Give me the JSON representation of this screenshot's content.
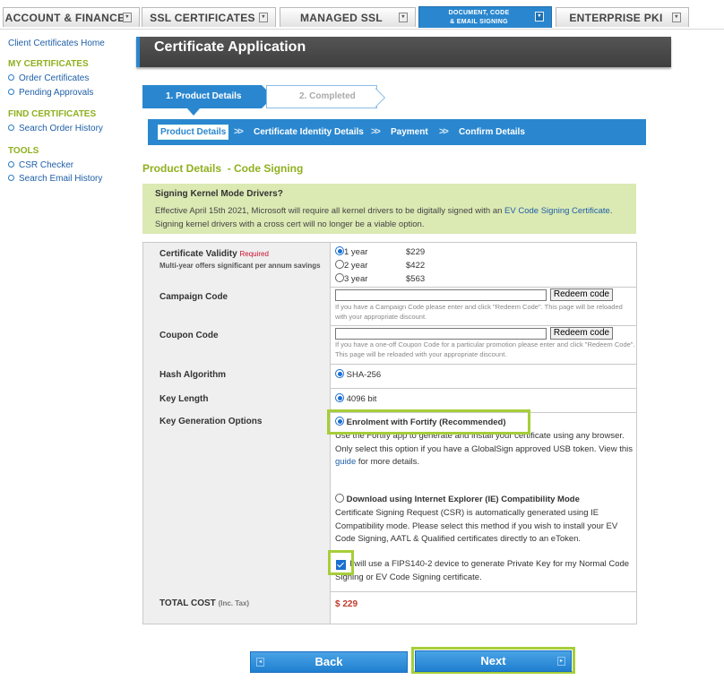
{
  "topnav": {
    "tabs": [
      {
        "label": "ACCOUNT & FINANCE"
      },
      {
        "label": "SSL CERTIFICATES"
      },
      {
        "label": "MANAGED SSL"
      },
      {
        "label_line1": "DOCUMENT, CODE",
        "label_line2": "& EMAIL SIGNING",
        "active": true
      },
      {
        "label": "ENTERPRISE PKI"
      }
    ]
  },
  "sidebar": {
    "home": "Client Certificates Home",
    "sections": [
      {
        "title": "MY CERTIFICATES",
        "items": [
          "Order Certificates",
          "Pending Approvals"
        ]
      },
      {
        "title": "FIND CERTIFICATES",
        "items": [
          "Search Order History"
        ]
      },
      {
        "title": "TOOLS",
        "items": [
          "CSR Checker",
          "Search Email History"
        ]
      }
    ]
  },
  "page_title": "Certificate Application",
  "steps": {
    "step1": "1. Product Details",
    "step2": "2. Completed"
  },
  "substeps": [
    "Product Details",
    "Certificate Identity Details",
    "Payment",
    "Confirm Details"
  ],
  "section_title": "Product Details  - Code Signing",
  "notice": {
    "title": "Signing Kernel Mode Drivers?",
    "body_pre": "Effective April 15th 2021, Microsoft will require all kernel drivers to be digitally signed with an ",
    "body_link": "EV Code Signing Certificate",
    "body_post": ". Signing kernel drivers with a cross cert will no longer be a viable option."
  },
  "form": {
    "validity": {
      "label": "Certificate Validity",
      "required": "Required",
      "note": "Multi-year offers significant per annum savings",
      "options": [
        {
          "term": "1 year",
          "price": "$229",
          "selected": true
        },
        {
          "term": "2 year",
          "price": "$422",
          "selected": false
        },
        {
          "term": "3 year",
          "price": "$563",
          "selected": false
        }
      ]
    },
    "campaign": {
      "label": "Campaign Code",
      "value": "",
      "button": "Redeem code",
      "hint": "If you have a Campaign Code please enter and click \"Redeem Code\". This page will be reloaded with your appropriate discount."
    },
    "coupon": {
      "label": "Coupon Code",
      "value": "",
      "button": "Redeem code",
      "hint": "If you have a one-off Coupon Code for a particular promotion please enter and click \"Redeem Code\". This page will be reloaded with your appropriate discount."
    },
    "hash": {
      "label": "Hash Algorithm",
      "value": "SHA-256"
    },
    "keylen": {
      "label": "Key Length",
      "value": "4096 bit"
    },
    "keygen": {
      "label": "Key Generation Options",
      "option1_title": "Enrolment with Fortify (Recommended)",
      "option1_desc_a": "Use the Fortify app to generate and install your certificate using any browser. Only select this option if you have a GlobalSign approved USB token. View this ",
      "option1_link": "guide",
      "option1_desc_b": " for more details.",
      "option2_title": "Download using Internet Explorer (IE) Compatibility Mode",
      "option2_desc": "Certificate Signing Request (CSR) is automatically generated using IE Compatibility mode. Please select this method if you wish to install your EV Code Signing, AATL & Qualified certificates directly to an eToken.",
      "fips_text": "I will use a FIPS140-2 device to generate Private Key for my Normal Code Signing or EV Code Signing certificate.",
      "fips_checked": true
    },
    "total": {
      "label": "TOTAL COST",
      "label_note": "(Inc. Tax)",
      "value": "$ 229"
    }
  },
  "buttons": {
    "back": "Back",
    "next": "Next"
  }
}
